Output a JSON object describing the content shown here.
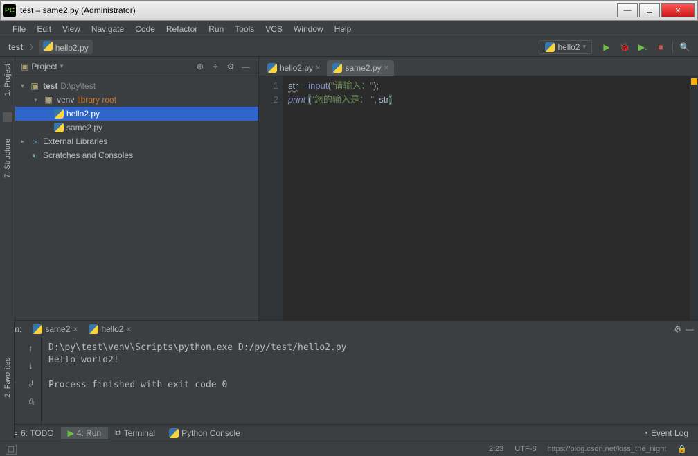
{
  "title_bar": {
    "app_icon_text": "PC",
    "title": "test – same2.py (Administrator)"
  },
  "menu": {
    "items": [
      "File",
      "Edit",
      "View",
      "Navigate",
      "Code",
      "Refactor",
      "Run",
      "Tools",
      "VCS",
      "Window",
      "Help"
    ]
  },
  "breadcrumbs": {
    "root": "test",
    "file": "hello2.py"
  },
  "run_config": {
    "name": "hello2"
  },
  "project_panel": {
    "title": "Project",
    "root": {
      "name": "test",
      "path": "D:\\py\\test"
    },
    "venv": {
      "name": "venv",
      "badge": "library root"
    },
    "file1": "hello2.py",
    "file2": "same2.py",
    "ext_lib": "External Libraries",
    "scratches": "Scratches and Consoles"
  },
  "editor": {
    "tabs": [
      {
        "name": "hello2.py",
        "active": false
      },
      {
        "name": "same2.py",
        "active": true
      }
    ],
    "lines": [
      "1",
      "2"
    ],
    "code": {
      "l1_id": "str",
      "l1_eq": " = ",
      "l1_fn": "input",
      "l1_str": "\"请输入：\"",
      "l1_end": ";",
      "l2_fn": "print",
      "l2_str": "\"您的输入是： \"",
      "l2_sep": ", ",
      "l2_arg": "str"
    }
  },
  "run_panel": {
    "label": "Run:",
    "tabs": [
      "same2",
      "hello2"
    ],
    "console": "D:\\py\\test\\venv\\Scripts\\python.exe D:/py/test/hello2.py\nHello world2!\n\nProcess finished with exit code 0"
  },
  "bottom_tabs": {
    "todo": "6: TODO",
    "run": "4: Run",
    "terminal": "Terminal",
    "pyconsole": "Python Console",
    "event_log": "Event Log"
  },
  "status_bar": {
    "pos": "2:23",
    "enc": "UTF-8",
    "watermark": "https://blog.csdn.net/kiss_the_night"
  }
}
